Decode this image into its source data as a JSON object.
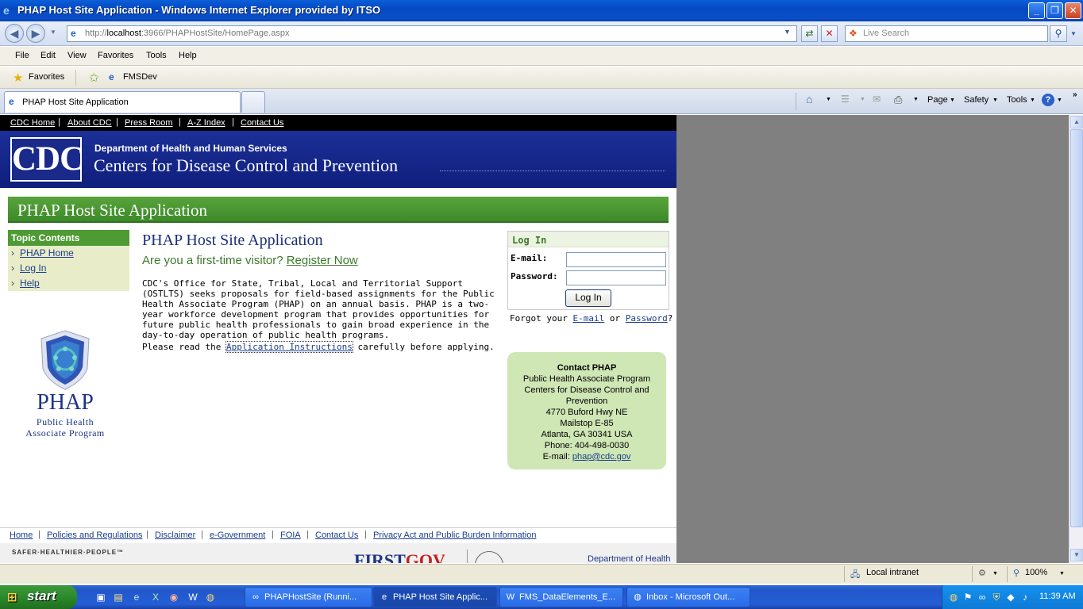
{
  "window": {
    "title": "PHAP Host Site Application - Windows Internet Explorer provided by ITSO"
  },
  "browser": {
    "url_prefix": "http://",
    "url_host": "localhost",
    "url_rest": ":3966/PHAPHostSite/HomePage.aspx",
    "search_placeholder": "Live Search",
    "menu": [
      "File",
      "Edit",
      "View",
      "Favorites",
      "Tools",
      "Help"
    ],
    "favorites_label": "Favorites",
    "fav_link": "FMSDev",
    "tab_title": "PHAP Host Site Application",
    "commands": {
      "page": "Page",
      "safety": "Safety",
      "tools": "Tools"
    },
    "status": {
      "zone": "Local intranet",
      "zoom": "100%"
    }
  },
  "cdc": {
    "nav": [
      "CDC Home",
      "About CDC",
      "Press Room",
      "A-Z Index",
      "Contact Us"
    ],
    "logo": "CDC",
    "dept": "Department of Health and Human Services",
    "name": "Centers for Disease Control and Prevention",
    "banner_title": "PHAP Host Site Application"
  },
  "sidebar": {
    "heading": "Topic Contents",
    "items": [
      "PHAP Home",
      "Log In",
      "Help"
    ],
    "logo_name": "PHAP",
    "logo_sub1": "Public Health",
    "logo_sub2": "Associate Program"
  },
  "main": {
    "title": "PHAP Host Site Application",
    "visitor_q": "Are you a first-time visitor?",
    "register": "Register Now",
    "intro": "CDC's Office for State, Tribal, Local and Territorial Support (OSTLTS) seeks proposals for field-based assignments for the Public Health Associate Program (PHAP) on an annual basis. PHAP is a two-year workforce development program that provides opportunities for future public health professionals to gain broad experience in the day-to-day operation of public health programs.",
    "read_pre": "Please read the",
    "read_link": "Application Instructions",
    "read_post": "carefully before applying."
  },
  "login": {
    "heading": "Log In",
    "email_label": "E-mail:",
    "password_label": "Password:",
    "button": "Log In",
    "forgot_pre": "Forgot your",
    "forgot_email": "E-mail",
    "forgot_or": "or",
    "forgot_password": "Password",
    "forgot_q": "?"
  },
  "contact": {
    "heading": "Contact PHAP",
    "lines": [
      "Public Health Associate Program",
      "Centers for Disease Control and",
      "Prevention",
      "4770 Buford Hwy NE",
      "Mailstop E-85",
      "Atlanta, GA 30341 USA",
      "Phone: 404-498-0030"
    ],
    "email_label": "E-mail:",
    "email": "phap@cdc.gov"
  },
  "footer": {
    "links": [
      "Home",
      "Policies and Regulations",
      "Disclaimer",
      "e-Government",
      "FOIA",
      "Contact Us",
      "Privacy Act and Public Burden Information"
    ],
    "tagline": "SAFER·HEALTHIER·PEOPLE™",
    "firstgov1": "FIRST",
    "firstgov2": "GOV",
    "dept": "Department of Health"
  },
  "taskbar": {
    "start": "start",
    "tasks": [
      "PHAPHostSite (Runni...",
      "PHAP Host Site Applic...",
      "FMS_DataElements_E...",
      "Inbox - Microsoft Out..."
    ],
    "clock": "11:39 AM"
  }
}
